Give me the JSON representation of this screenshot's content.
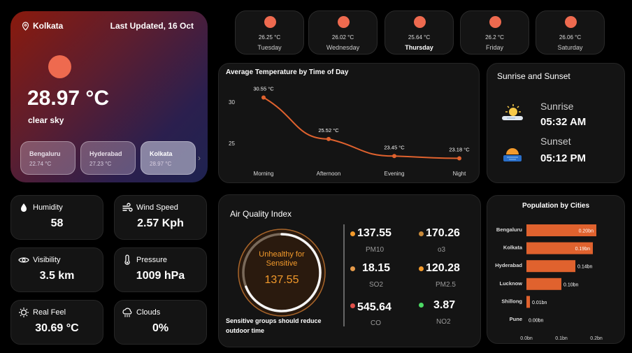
{
  "hero": {
    "location": "Kolkata",
    "updated": "Last Updated, 16 Oct",
    "temperature": "28.97 °C",
    "description": "clear sky",
    "cities": [
      {
        "name": "Bengaluru",
        "temp": "22.74 °C"
      },
      {
        "name": "Hyderabad",
        "temp": "27.23 °C"
      },
      {
        "name": "Kolkata",
        "temp": "28.97 °C"
      }
    ]
  },
  "forecast": [
    {
      "temp": "26.25 °C",
      "day": "Tuesday"
    },
    {
      "temp": "26.02 °C",
      "day": "Wednesday"
    },
    {
      "temp": "25.64 °C",
      "day": "Thursday"
    },
    {
      "temp": "26.2 °C",
      "day": "Friday"
    },
    {
      "temp": "26.06 °C",
      "day": "Saturday"
    }
  ],
  "avg_temp": {
    "title": "Average Temperature by Time of Day",
    "points": [
      {
        "label": "Morning",
        "value": 30.55,
        "text": "30.55 °C"
      },
      {
        "label": "Afternoon",
        "value": 25.52,
        "text": "25.52 °C"
      },
      {
        "label": "Evening",
        "value": 23.45,
        "text": "23.45 °C"
      },
      {
        "label": "Night",
        "value": 23.18,
        "text": "23.18 °C"
      }
    ],
    "yticks": [
      "30",
      "25"
    ]
  },
  "sun": {
    "title": "Sunrise and Sunset",
    "sunrise_label": "Sunrise",
    "sunrise_time": "05:32 AM",
    "sunset_label": "Sunset",
    "sunset_time": "05:12 PM"
  },
  "stats": [
    {
      "label": "Humidity",
      "value": "58"
    },
    {
      "label": "Wind Speed",
      "value": "2.57 Kph"
    },
    {
      "label": "Visibility",
      "value": "3.5 km"
    },
    {
      "label": "Pressure",
      "value": "1009 hPa"
    },
    {
      "label": "Real Feel",
      "value": "30.69 °C"
    },
    {
      "label": "Clouds",
      "value": "0%"
    }
  ],
  "aqi": {
    "title": "Air Quality Index",
    "status": "Unhealthy for Sensitive",
    "value": "137.55",
    "gauge_fraction": 0.69,
    "advice": "Sensitive groups should reduce outdoor time",
    "pollutants": [
      {
        "name": "PM10",
        "value": "137.55",
        "color": "#f39a2b"
      },
      {
        "name": "o3",
        "value": "170.26",
        "color": "#c98a3a"
      },
      {
        "name": "SO2",
        "value": "18.15",
        "color": "#e59a4a"
      },
      {
        "name": "PM2.5",
        "value": "120.28",
        "color": "#f39a2b"
      },
      {
        "name": "CO",
        "value": "545.64",
        "color": "#e0504a"
      },
      {
        "name": "NO2",
        "value": "3.87",
        "color": "#4cd964"
      }
    ]
  },
  "chart_data": {
    "type": "bar",
    "title": "Population by Cities",
    "categories": [
      "Bengaluru",
      "Kolkata",
      "Hyderabad",
      "Lucknow",
      "Shillong",
      "Pune"
    ],
    "values": [
      0.2,
      0.19,
      0.14,
      0.1,
      0.01,
      0.0
    ],
    "value_labels": [
      "0.20bn",
      "0.19bn",
      "0.14bn",
      "0.10bn",
      "0.01bn",
      "0.00bn"
    ],
    "xticks": [
      "0.0bn",
      "0.1bn",
      "0.2bn"
    ],
    "xlim": [
      0,
      0.2
    ],
    "color": "#e0622e"
  }
}
